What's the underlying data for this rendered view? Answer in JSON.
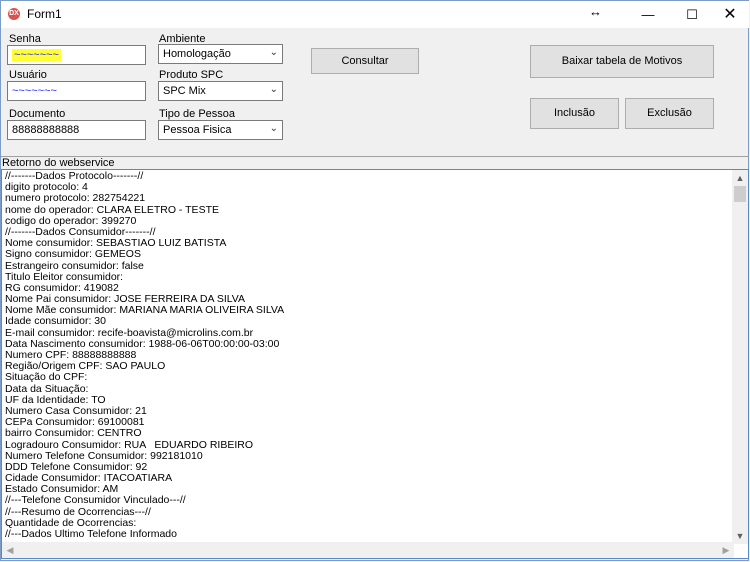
{
  "window": {
    "title": "Form1",
    "resize_glyph": "↔",
    "minimize": "—",
    "maximize": "☐",
    "close": "✕"
  },
  "form": {
    "senha": {
      "label": "Senha",
      "value": "~~~~~~~"
    },
    "usuario": {
      "label": "Usuário",
      "value": "~~~~~~~"
    },
    "documento": {
      "label": "Documento",
      "value": "88888888888"
    },
    "ambiente": {
      "label": "Ambiente",
      "value": "Homologação"
    },
    "produto": {
      "label": "Produto SPC",
      "value": "SPC Mix"
    },
    "tipo_pessoa": {
      "label": "Tipo de Pessoa",
      "value": "Pessoa Fisica"
    }
  },
  "buttons": {
    "consultar": "Consultar",
    "baixar": "Baixar tabela de Motivos",
    "inclusao": "Inclusão",
    "exclusao": "Exclusão"
  },
  "output": {
    "label": "Retorno do webservice",
    "lines": [
      "//-------Dados Protocolo-------//",
      "digito protocolo: 4",
      "numero protocolo: 282754221",
      "nome do operador: CLARA ELETRO - TESTE",
      "codigo do operador: 399270",
      "//-------Dados Consumidor-------//",
      "Nome consumidor: SEBASTIAO LUIZ BATISTA",
      "Signo consumidor: GEMEOS",
      "Estrangeiro consumidor: false",
      "Titulo Eleitor consumidor:",
      "RG consumidor: 419082",
      "Nome Pai consumidor: JOSE FERREIRA DA SILVA",
      "Nome Mãe consumidor: MARIANA MARIA OLIVEIRA SILVA",
      "Idade consumidor: 30",
      "E-mail consumidor: recife-boavista@microlins.com.br",
      "Data Nascimento consumidor: 1988-06-06T00:00:00-03:00",
      "Numero CPF: 88888888888",
      "Região/Origem CPF: SAO PAULO",
      "Situação do CPF:",
      "Data da Situação:",
      "UF da Identidade: TO",
      "Numero Casa Consumidor: 21",
      "CEPa Consumidor: 69100081",
      "bairro Consumidor: CENTRO",
      "Logradouro Consumidor: RUA   EDUARDO RIBEIRO",
      "Numero Telefone Consumidor: 992181010",
      "DDD Telefone Consumidor: 92",
      "Cidade Consumidor: ITACOATIARA",
      "Estado Consumidor: AM",
      "//---Telefone Consumidor Vinculado---//",
      "//---Resumo de Ocorrencias---//",
      "Quantidade de Ocorrencias:",
      "//---Dados Ultimo Telefone Informado"
    ]
  },
  "colors": {
    "highlight": "#ffff33",
    "scribble": "#2a2aff",
    "border_accent": "#5a8ac6"
  }
}
